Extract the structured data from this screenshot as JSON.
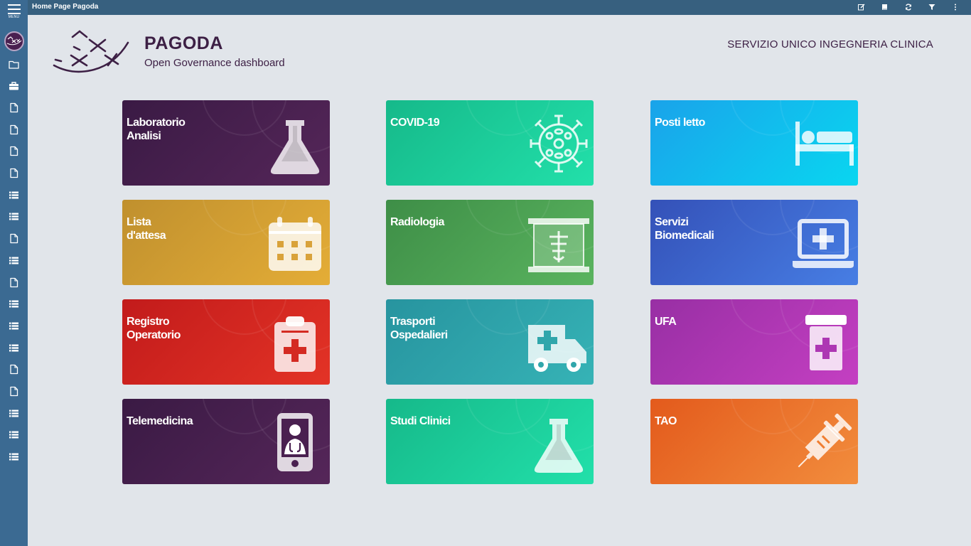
{
  "topbar": {
    "title": "Home Page Pagoda",
    "tools": [
      "edit-icon",
      "book-icon",
      "refresh-icon",
      "filter-icon",
      "more-vertical-icon"
    ]
  },
  "sidebar": {
    "menu_label": "MENU",
    "items": [
      "folder-icon",
      "briefcase-icon",
      "document-icon",
      "document-icon",
      "document-icon",
      "document-icon",
      "list-icon",
      "list-icon",
      "document-icon",
      "list-icon",
      "document-icon",
      "list-icon",
      "list-icon",
      "list-icon",
      "document-icon",
      "document-icon",
      "list-icon",
      "list-icon",
      "list-icon"
    ]
  },
  "header": {
    "title": "PAGODA",
    "subtitle": "Open Governance dashboard",
    "org": "SERVIZIO UNICO INGEGNERIA CLINICA"
  },
  "tiles": [
    {
      "label": "Laboratorio\nAnalisi",
      "icon": "flask-icon",
      "colors": [
        "#3a1a44",
        "#552659"
      ]
    },
    {
      "label": "COVID-19",
      "icon": "virus-icon",
      "colors": [
        "#16b98a",
        "#22e0aa"
      ]
    },
    {
      "label": "Posti letto",
      "icon": "bed-icon",
      "colors": [
        "#1aa3ea",
        "#09d6f0"
      ]
    },
    {
      "label": "Lista\nd'attesa",
      "icon": "calendar-icon",
      "colors": [
        "#c0902e",
        "#e4ad37"
      ]
    },
    {
      "label": "Radiologia",
      "icon": "xray-icon",
      "colors": [
        "#3e8e47",
        "#5ab45f"
      ]
    },
    {
      "label": "Servizi\nBiomedicali",
      "icon": "laptop-medical-icon",
      "colors": [
        "#3451b8",
        "#477ee4"
      ]
    },
    {
      "label": "Registro\nOperatorio",
      "icon": "clipboard-medical-icon",
      "colors": [
        "#c21b1b",
        "#e33326"
      ]
    },
    {
      "label": "Trasporti\nOspedalieri",
      "icon": "ambulance-icon",
      "colors": [
        "#27949f",
        "#36b3b6"
      ]
    },
    {
      "label": "UFA",
      "icon": "pill-bottle-icon",
      "colors": [
        "#982fa4",
        "#c43fc2"
      ]
    },
    {
      "label": "Telemedicina",
      "icon": "mobile-doctor-icon",
      "colors": [
        "#3a1a44",
        "#552659"
      ]
    },
    {
      "label": "Studi Clinici",
      "icon": "flask-icon",
      "colors": [
        "#16b98a",
        "#22e0aa"
      ]
    },
    {
      "label": "TAO",
      "icon": "syringe-icon",
      "colors": [
        "#e35a1c",
        "#f28d3d"
      ]
    }
  ]
}
